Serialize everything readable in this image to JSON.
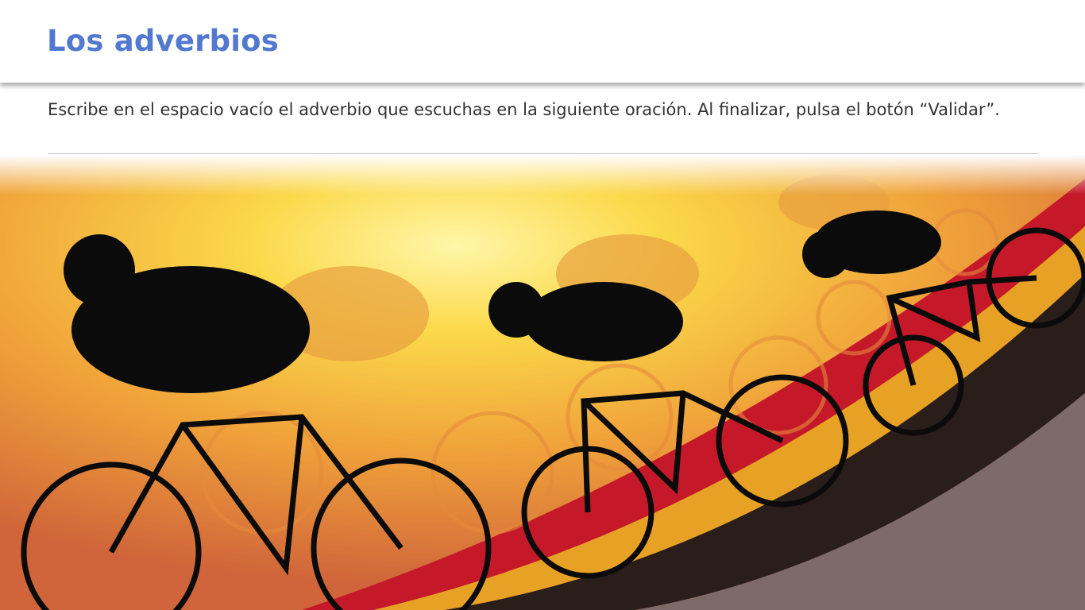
{
  "header": {
    "title": "Los adverbios"
  },
  "instructions": {
    "text": "Escribe en el espacio vacío el  adverbio que escuchas en la siguiente oración. Al finalizar, pulsa el botón “Validar”."
  },
  "image": {
    "subject": "cyclists-silhouette-illustration"
  },
  "colors": {
    "title": "#5279cf",
    "text": "#333333"
  }
}
